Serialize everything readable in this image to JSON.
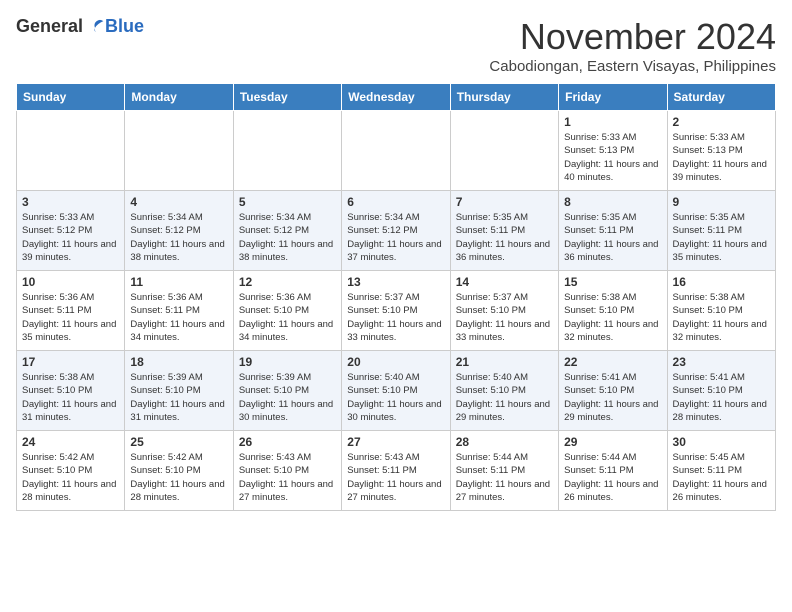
{
  "logo": {
    "general": "General",
    "blue": "Blue"
  },
  "title": {
    "month": "November 2024",
    "location": "Cabodiongan, Eastern Visayas, Philippines"
  },
  "weekdays": [
    "Sunday",
    "Monday",
    "Tuesday",
    "Wednesday",
    "Thursday",
    "Friday",
    "Saturday"
  ],
  "weeks": [
    [
      {
        "day": "",
        "info": ""
      },
      {
        "day": "",
        "info": ""
      },
      {
        "day": "",
        "info": ""
      },
      {
        "day": "",
        "info": ""
      },
      {
        "day": "",
        "info": ""
      },
      {
        "day": "1",
        "info": "Sunrise: 5:33 AM\nSunset: 5:13 PM\nDaylight: 11 hours\nand 40 minutes."
      },
      {
        "day": "2",
        "info": "Sunrise: 5:33 AM\nSunset: 5:13 PM\nDaylight: 11 hours\nand 39 minutes."
      }
    ],
    [
      {
        "day": "3",
        "info": "Sunrise: 5:33 AM\nSunset: 5:12 PM\nDaylight: 11 hours\nand 39 minutes."
      },
      {
        "day": "4",
        "info": "Sunrise: 5:34 AM\nSunset: 5:12 PM\nDaylight: 11 hours\nand 38 minutes."
      },
      {
        "day": "5",
        "info": "Sunrise: 5:34 AM\nSunset: 5:12 PM\nDaylight: 11 hours\nand 38 minutes."
      },
      {
        "day": "6",
        "info": "Sunrise: 5:34 AM\nSunset: 5:12 PM\nDaylight: 11 hours\nand 37 minutes."
      },
      {
        "day": "7",
        "info": "Sunrise: 5:35 AM\nSunset: 5:11 PM\nDaylight: 11 hours\nand 36 minutes."
      },
      {
        "day": "8",
        "info": "Sunrise: 5:35 AM\nSunset: 5:11 PM\nDaylight: 11 hours\nand 36 minutes."
      },
      {
        "day": "9",
        "info": "Sunrise: 5:35 AM\nSunset: 5:11 PM\nDaylight: 11 hours\nand 35 minutes."
      }
    ],
    [
      {
        "day": "10",
        "info": "Sunrise: 5:36 AM\nSunset: 5:11 PM\nDaylight: 11 hours\nand 35 minutes."
      },
      {
        "day": "11",
        "info": "Sunrise: 5:36 AM\nSunset: 5:11 PM\nDaylight: 11 hours\nand 34 minutes."
      },
      {
        "day": "12",
        "info": "Sunrise: 5:36 AM\nSunset: 5:10 PM\nDaylight: 11 hours\nand 34 minutes."
      },
      {
        "day": "13",
        "info": "Sunrise: 5:37 AM\nSunset: 5:10 PM\nDaylight: 11 hours\nand 33 minutes."
      },
      {
        "day": "14",
        "info": "Sunrise: 5:37 AM\nSunset: 5:10 PM\nDaylight: 11 hours\nand 33 minutes."
      },
      {
        "day": "15",
        "info": "Sunrise: 5:38 AM\nSunset: 5:10 PM\nDaylight: 11 hours\nand 32 minutes."
      },
      {
        "day": "16",
        "info": "Sunrise: 5:38 AM\nSunset: 5:10 PM\nDaylight: 11 hours\nand 32 minutes."
      }
    ],
    [
      {
        "day": "17",
        "info": "Sunrise: 5:38 AM\nSunset: 5:10 PM\nDaylight: 11 hours\nand 31 minutes."
      },
      {
        "day": "18",
        "info": "Sunrise: 5:39 AM\nSunset: 5:10 PM\nDaylight: 11 hours\nand 31 minutes."
      },
      {
        "day": "19",
        "info": "Sunrise: 5:39 AM\nSunset: 5:10 PM\nDaylight: 11 hours\nand 30 minutes."
      },
      {
        "day": "20",
        "info": "Sunrise: 5:40 AM\nSunset: 5:10 PM\nDaylight: 11 hours\nand 30 minutes."
      },
      {
        "day": "21",
        "info": "Sunrise: 5:40 AM\nSunset: 5:10 PM\nDaylight: 11 hours\nand 29 minutes."
      },
      {
        "day": "22",
        "info": "Sunrise: 5:41 AM\nSunset: 5:10 PM\nDaylight: 11 hours\nand 29 minutes."
      },
      {
        "day": "23",
        "info": "Sunrise: 5:41 AM\nSunset: 5:10 PM\nDaylight: 11 hours\nand 28 minutes."
      }
    ],
    [
      {
        "day": "24",
        "info": "Sunrise: 5:42 AM\nSunset: 5:10 PM\nDaylight: 11 hours\nand 28 minutes."
      },
      {
        "day": "25",
        "info": "Sunrise: 5:42 AM\nSunset: 5:10 PM\nDaylight: 11 hours\nand 28 minutes."
      },
      {
        "day": "26",
        "info": "Sunrise: 5:43 AM\nSunset: 5:10 PM\nDaylight: 11 hours\nand 27 minutes."
      },
      {
        "day": "27",
        "info": "Sunrise: 5:43 AM\nSunset: 5:11 PM\nDaylight: 11 hours\nand 27 minutes."
      },
      {
        "day": "28",
        "info": "Sunrise: 5:44 AM\nSunset: 5:11 PM\nDaylight: 11 hours\nand 27 minutes."
      },
      {
        "day": "29",
        "info": "Sunrise: 5:44 AM\nSunset: 5:11 PM\nDaylight: 11 hours\nand 26 minutes."
      },
      {
        "day": "30",
        "info": "Sunrise: 5:45 AM\nSunset: 5:11 PM\nDaylight: 11 hours\nand 26 minutes."
      }
    ]
  ]
}
